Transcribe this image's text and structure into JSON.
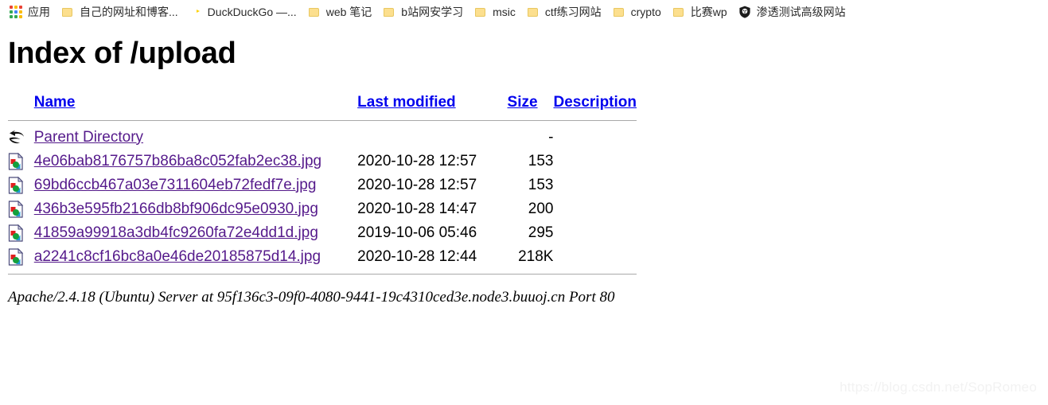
{
  "browser": {
    "bookmarks": [
      {
        "label": "应用",
        "icon": "apps-grid-icon"
      },
      {
        "label": "自己的网址和博客...",
        "icon": "folder-icon"
      },
      {
        "label": "DuckDuckGo —...",
        "icon": "duckduckgo-icon"
      },
      {
        "label": "web 笔记",
        "icon": "folder-icon"
      },
      {
        "label": "b站网安学习",
        "icon": "folder-icon"
      },
      {
        "label": "msic",
        "icon": "folder-icon"
      },
      {
        "label": "ctf练习网站",
        "icon": "folder-icon"
      },
      {
        "label": "crypto",
        "icon": "folder-icon"
      },
      {
        "label": "比赛wp",
        "icon": "folder-icon"
      },
      {
        "label": "渗透测试高级网站",
        "icon": "shield-icon"
      }
    ]
  },
  "page": {
    "title": "Index of /upload",
    "columns": {
      "name": "Name",
      "last_modified": "Last modified",
      "size": "Size",
      "description": "Description"
    },
    "rows": [
      {
        "icon": "parent-directory-icon",
        "name": "Parent Directory",
        "last_modified": "",
        "size": "-",
        "description": ""
      },
      {
        "icon": "image-file-icon",
        "name": "4e06bab8176757b86ba8c052fab2ec38.jpg",
        "last_modified": "2020-10-28 12:57",
        "size": "153",
        "description": ""
      },
      {
        "icon": "image-file-icon",
        "name": "69bd6ccb467a03e7311604eb72fedf7e.jpg",
        "last_modified": "2020-10-28 12:57",
        "size": "153",
        "description": ""
      },
      {
        "icon": "image-file-icon",
        "name": "436b3e595fb2166db8bf906dc95e0930.jpg",
        "last_modified": "2020-10-28 14:47",
        "size": "200",
        "description": ""
      },
      {
        "icon": "image-file-icon",
        "name": "41859a99918a3db4fc9260fa72e4dd1d.jpg",
        "last_modified": "2019-10-06 05:46",
        "size": "295",
        "description": ""
      },
      {
        "icon": "image-file-icon",
        "name": "a2241c8cf16bc8a0e46de20185875d14.jpg",
        "last_modified": "2020-10-28 12:44",
        "size": "218K",
        "description": ""
      }
    ],
    "footer": "Apache/2.4.18 (Ubuntu) Server at 95f136c3-09f0-4080-9441-19c4310ced3e.node3.buuoj.cn Port 80"
  },
  "watermark": "https://blog.csdn.net/SopRomeo",
  "colors": {
    "link_unvisited": "#0000ee",
    "link_visited": "#551a8b",
    "rule": "#a9a9a9",
    "folder": "#fcdf8e",
    "duckduckgo": "#de5833"
  }
}
